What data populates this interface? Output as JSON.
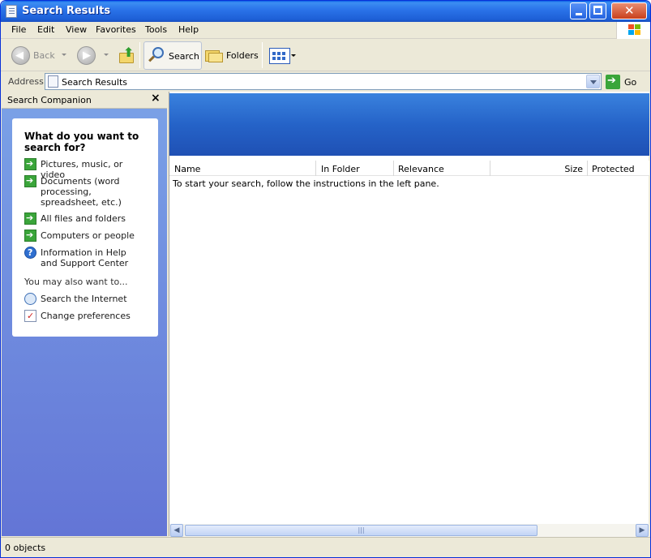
{
  "window": {
    "title": "Search Results",
    "icon": "search-results-icon"
  },
  "menu": [
    "File",
    "Edit",
    "View",
    "Favorites",
    "Tools",
    "Help"
  ],
  "toolbar": {
    "back_label": "Back",
    "search_label": "Search",
    "folders_label": "Folders"
  },
  "address": {
    "label": "Address",
    "value": "Search Results",
    "go_label": "Go"
  },
  "left_pane": {
    "title": "Search Companion",
    "close_glyph": "×",
    "question": "What do you want to search for?",
    "options": [
      {
        "label": "Pictures, music, or video",
        "icon": "green-arrow-icon"
      },
      {
        "label": "Documents (word processing, spreadsheet, etc.)",
        "icon": "green-arrow-icon"
      },
      {
        "label": "All files and folders",
        "icon": "green-arrow-icon"
      },
      {
        "label": "Computers or people",
        "icon": "green-arrow-icon"
      },
      {
        "label": "Information in Help and Support Center",
        "icon": "help-icon"
      }
    ],
    "also_label": "You may also want to...",
    "also_options": [
      {
        "label": "Search the Internet",
        "icon": "globe-search-icon"
      },
      {
        "label": "Change preferences",
        "icon": "preferences-icon"
      }
    ]
  },
  "results": {
    "columns": [
      "Name",
      "In Folder",
      "Relevance",
      "Size",
      "Protected"
    ],
    "hint": "To start your search, follow the instructions in the left pane."
  },
  "status": {
    "text": "0 objects"
  },
  "colors": {
    "title_bar": "#2b74ea",
    "left_pane_top": "#7ba2e7",
    "left_pane_bottom": "#6375d6",
    "banner": "#2563c8"
  }
}
